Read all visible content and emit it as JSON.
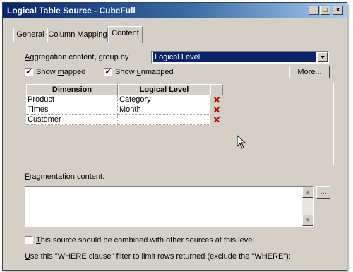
{
  "window": {
    "title": "Logical Table Source - CubeFull",
    "minimize": "_",
    "maximize": "□",
    "close": "×"
  },
  "tabs": [
    {
      "label": "General"
    },
    {
      "label": "Column Mapping"
    },
    {
      "label": "Content"
    }
  ],
  "aggregation": {
    "label_u": "A",
    "label_rest": "ggregation content, group by",
    "selected": "Logical Level"
  },
  "show_mapped": {
    "pre": "Show ",
    "u": "m",
    "post": "apped",
    "checked": "✓"
  },
  "show_unmapped": {
    "pre": "Show ",
    "u": "u",
    "post": "nmapped",
    "checked": "✓"
  },
  "more_button": "More...",
  "grid": {
    "columns": [
      "Dimension",
      "Logical Level"
    ],
    "rows": [
      {
        "dimension": "Product",
        "level": "Category"
      },
      {
        "dimension": "Times",
        "level": "Month"
      },
      {
        "dimension": "Customer",
        "level": ""
      }
    ],
    "delete_glyph": "✕"
  },
  "fragmentation": {
    "label_u": "F",
    "label_rest": "ragmentation content:",
    "browse": "...",
    "scroll_up": "▲",
    "scroll_down": "▼"
  },
  "combine": {
    "u": "T",
    "rest": "his source should be combined with other sources at this level"
  },
  "where": {
    "u": "U",
    "rest": "se this \"WHERE clause\" filter to limit rows returned (exclude the \"WHERE\"):"
  }
}
